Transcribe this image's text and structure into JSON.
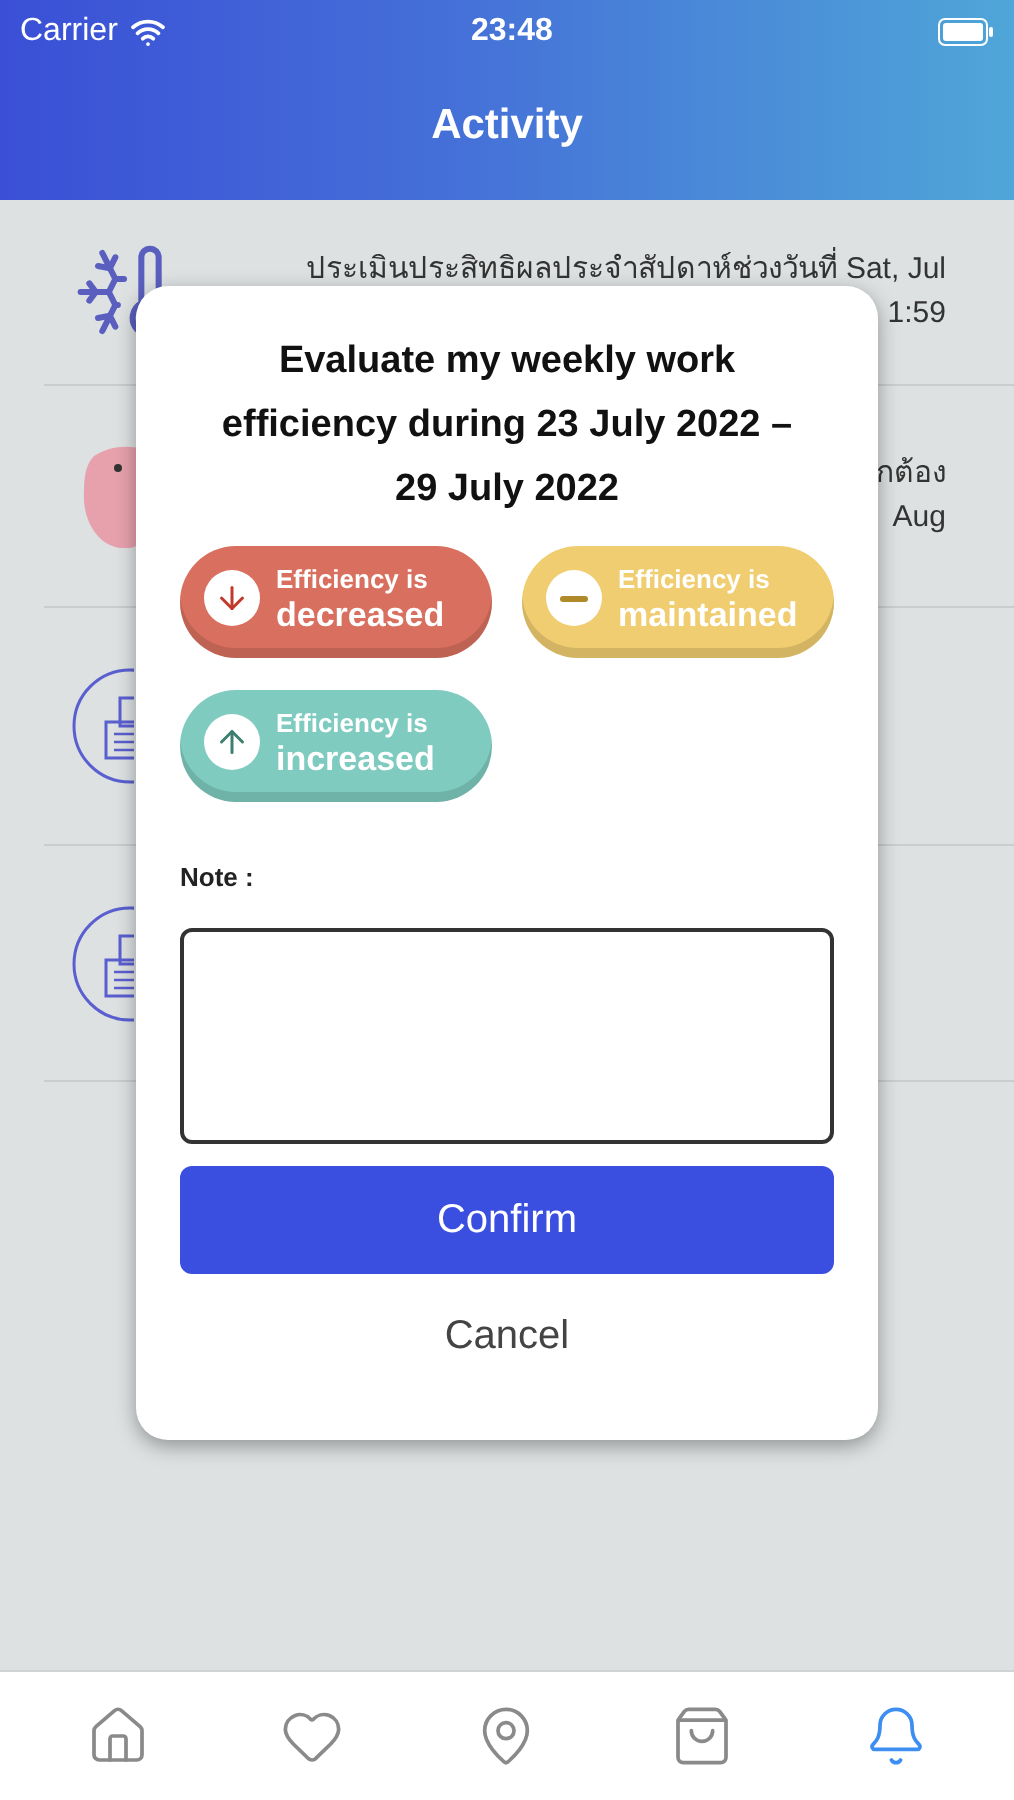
{
  "status_bar": {
    "carrier": "Carrier",
    "time": "23:48"
  },
  "header": {
    "title": "Activity"
  },
  "activities": [
    {
      "kind": "snow",
      "lines": [
        "ประเมินประสิทธิผลประจำสัปดาห์ช่วงวันที่ Sat, Jul",
        "1:59"
      ]
    },
    {
      "kind": "blob",
      "lines": [
        "กต้อง",
        "Aug"
      ]
    },
    {
      "kind": "printer"
    },
    {
      "kind": "printer"
    }
  ],
  "dialog": {
    "title": "Evaluate my weekly work efficiency during 23 July 2022 – 29 July 2022",
    "options": [
      {
        "kind": "down",
        "top": "Efficiency is",
        "bottom": "decreased",
        "color": "#d9705f",
        "selected": false
      },
      {
        "kind": "flat",
        "top": "Efficiency is",
        "bottom": "maintained",
        "color": "#f0cd70",
        "selected": false
      },
      {
        "kind": "up",
        "top": "Efficiency is",
        "bottom": "increased",
        "color": "#7fcbbf",
        "selected": false
      }
    ],
    "note_label": "Note :",
    "confirm": "Confirm",
    "cancel": "Cancel"
  },
  "tabs": [
    {
      "kind": "home",
      "selected": false
    },
    {
      "kind": "heart",
      "selected": false
    },
    {
      "kind": "pin",
      "selected": false
    },
    {
      "kind": "bag",
      "selected": false
    },
    {
      "kind": "bell",
      "selected": true
    }
  ]
}
